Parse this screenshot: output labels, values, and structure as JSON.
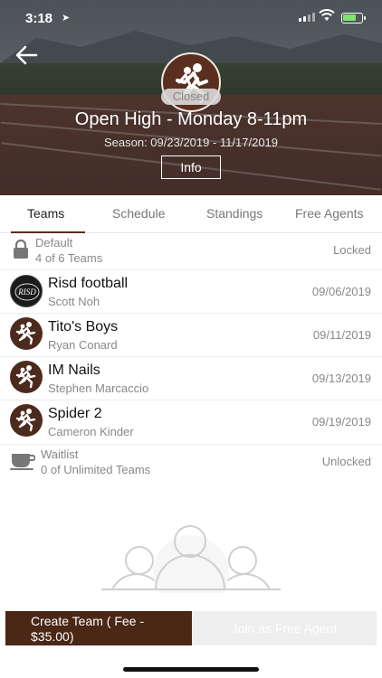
{
  "status_bar": {
    "time": "3:18",
    "battery_color": "#7ee36f"
  },
  "header": {
    "league_title": "Open High - Monday 8-11pm",
    "season": "Season: 09/23/2019 - 11/17/2019",
    "closed_label": "Closed",
    "info_label": "Info",
    "logo_icon": "runner-icon",
    "brand_color": "#4b2716"
  },
  "tabs": [
    {
      "label": "Teams",
      "active": true
    },
    {
      "label": "Schedule",
      "active": false
    },
    {
      "label": "Standings",
      "active": false
    },
    {
      "label": "Free Agents",
      "active": false
    }
  ],
  "default_group": {
    "title": "Default",
    "subtitle": "4 of 6 Teams",
    "status": "Locked"
  },
  "teams": [
    {
      "name": "Risd football",
      "captain": "Scott Noh",
      "date": "09/06/2019",
      "avatar": "risd-logo"
    },
    {
      "name": "Tito's Boys",
      "captain": "Ryan Conard",
      "date": "09/11/2019",
      "avatar": "runner-icon"
    },
    {
      "name": "IM Nails",
      "captain": "Stephen Marcaccio",
      "date": "09/13/2019",
      "avatar": "runner-icon"
    },
    {
      "name": "Spider 2",
      "captain": "Cameron Kinder",
      "date": "09/19/2019",
      "avatar": "runner-icon"
    }
  ],
  "waitlist": {
    "title": "Waitlist",
    "subtitle": "0 of Unlimited Teams",
    "status": "Unlocked"
  },
  "avatar_text": "RISD",
  "actions": {
    "create_team": "Create Team ( Fee - $35.00)",
    "join_free_agent": "Join as Free Agent"
  }
}
